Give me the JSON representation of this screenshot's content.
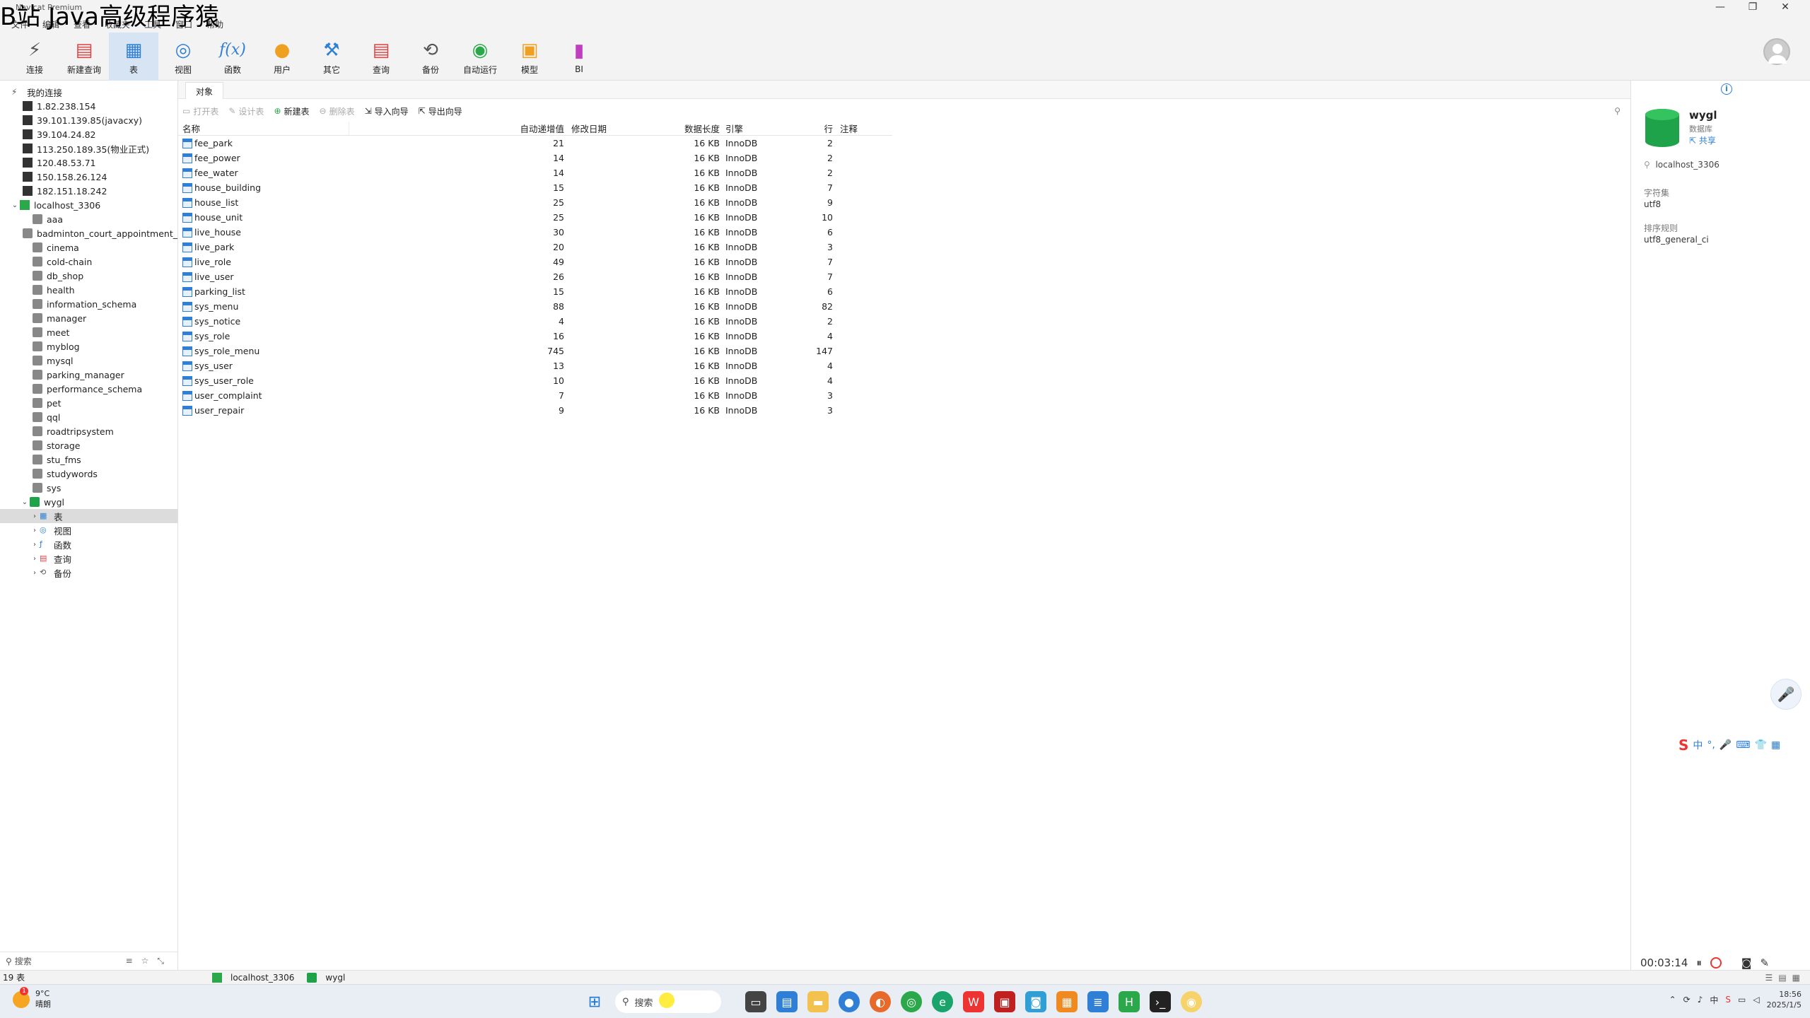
{
  "watermark": "B站 Java高级程序猿",
  "app_title": "Navicat Premium",
  "window_controls": [
    "—",
    "❐",
    "✕"
  ],
  "menu": [
    "文件",
    "编辑",
    "查看",
    "收藏夹",
    "工具",
    "窗口",
    "帮助"
  ],
  "toolbar": [
    {
      "label": "连接",
      "icon": "plug-icon",
      "color": "#555"
    },
    {
      "label": "新建查询",
      "icon": "new-query-icon",
      "color": "#e04040"
    },
    {
      "label": "表",
      "icon": "table-icon",
      "color": "#2f7fd6",
      "active": true
    },
    {
      "label": "视图",
      "icon": "view-icon",
      "color": "#2f7fd6"
    },
    {
      "label": "函数",
      "icon": "function-icon",
      "color": "#2f7fd6"
    },
    {
      "label": "用户",
      "icon": "user-icon",
      "color": "#f0a020"
    },
    {
      "label": "其它",
      "icon": "tools-icon",
      "color": "#2f7fd6"
    },
    {
      "label": "查询",
      "icon": "query-icon",
      "color": "#e04040"
    },
    {
      "label": "备份",
      "icon": "backup-icon",
      "color": "#555"
    },
    {
      "label": "自动运行",
      "icon": "robot-icon",
      "color": "#2aa84a"
    },
    {
      "label": "模型",
      "icon": "model-icon",
      "color": "#f0a020"
    },
    {
      "label": "BI",
      "icon": "bi-icon",
      "color": "#c03fc0"
    }
  ],
  "nav": {
    "root_label": "我的连接",
    "connections": [
      "1.82.238.154",
      "39.101.139.85(javacxy)",
      "39.104.24.82",
      "113.250.189.35(物业正式)",
      "120.48.53.71",
      "150.158.26.124",
      "182.151.18.242"
    ],
    "open_connection": "localhost_3306",
    "databases": [
      "aaa",
      "badminton_court_appointment_",
      "cinema",
      "cold-chain",
      "db_shop",
      "health",
      "information_schema",
      "manager",
      "meet",
      "myblog",
      "mysql",
      "parking_manager",
      "performance_schema",
      "pet",
      "qql",
      "roadtripsystem",
      "storage",
      "stu_fms",
      "studywords",
      "sys"
    ],
    "open_database": "wygl",
    "db_children": [
      {
        "label": "表",
        "icon": "table-icon"
      },
      {
        "label": "视图",
        "icon": "view-icon"
      },
      {
        "label": "函数",
        "icon": "function-icon"
      },
      {
        "label": "查询",
        "icon": "query-icon"
      },
      {
        "label": "备份",
        "icon": "backup-icon"
      }
    ],
    "search_placeholder": "搜索"
  },
  "tab_label": "对象",
  "obj_toolbar": {
    "open": "打开表",
    "design": "设计表",
    "new": "新建表",
    "delete": "删除表",
    "import": "导入向导",
    "export": "导出向导"
  },
  "grid": {
    "headers": [
      "名称",
      "自动递增值",
      "修改日期",
      "数据长度",
      "引擎",
      "行",
      "注释"
    ],
    "rows": [
      [
        "fee_park",
        "21",
        "",
        "16 KB",
        "InnoDB",
        "2",
        ""
      ],
      [
        "fee_power",
        "14",
        "",
        "16 KB",
        "InnoDB",
        "2",
        ""
      ],
      [
        "fee_water",
        "14",
        "",
        "16 KB",
        "InnoDB",
        "2",
        ""
      ],
      [
        "house_building",
        "15",
        "",
        "16 KB",
        "InnoDB",
        "7",
        ""
      ],
      [
        "house_list",
        "25",
        "",
        "16 KB",
        "InnoDB",
        "9",
        ""
      ],
      [
        "house_unit",
        "25",
        "",
        "16 KB",
        "InnoDB",
        "10",
        ""
      ],
      [
        "live_house",
        "30",
        "",
        "16 KB",
        "InnoDB",
        "6",
        ""
      ],
      [
        "live_park",
        "20",
        "",
        "16 KB",
        "InnoDB",
        "3",
        ""
      ],
      [
        "live_role",
        "49",
        "",
        "16 KB",
        "InnoDB",
        "7",
        ""
      ],
      [
        "live_user",
        "26",
        "",
        "16 KB",
        "InnoDB",
        "7",
        ""
      ],
      [
        "parking_list",
        "15",
        "",
        "16 KB",
        "InnoDB",
        "6",
        ""
      ],
      [
        "sys_menu",
        "88",
        "",
        "16 KB",
        "InnoDB",
        "82",
        ""
      ],
      [
        "sys_notice",
        "4",
        "",
        "16 KB",
        "InnoDB",
        "2",
        ""
      ],
      [
        "sys_role",
        "16",
        "",
        "16 KB",
        "InnoDB",
        "4",
        ""
      ],
      [
        "sys_role_menu",
        "745",
        "",
        "16 KB",
        "InnoDB",
        "147",
        ""
      ],
      [
        "sys_user",
        "13",
        "",
        "16 KB",
        "InnoDB",
        "4",
        ""
      ],
      [
        "sys_user_role",
        "10",
        "",
        "16 KB",
        "InnoDB",
        "4",
        ""
      ],
      [
        "user_complaint",
        "7",
        "",
        "16 KB",
        "InnoDB",
        "3",
        ""
      ],
      [
        "user_repair",
        "9",
        "",
        "16 KB",
        "InnoDB",
        "3",
        ""
      ]
    ]
  },
  "info": {
    "name": "wygl",
    "type": "数据库",
    "share": "共享",
    "connection": "localhost_3306",
    "charset_label": "字符集",
    "charset": "utf8",
    "collation_label": "排序规则",
    "collation": "utf8_general_ci"
  },
  "ime": [
    "中",
    "°,",
    "🎤",
    "⌨",
    "👕",
    "▦"
  ],
  "recorder": {
    "time": "00:03:14"
  },
  "status": {
    "count": "19 表",
    "connection": "localhost_3306",
    "database": "wygl"
  },
  "taskbar": {
    "weather_temp": "9°C",
    "weather_desc": "晴朗",
    "search": "搜索",
    "time": "18:56",
    "date": "2025/1/5"
  }
}
